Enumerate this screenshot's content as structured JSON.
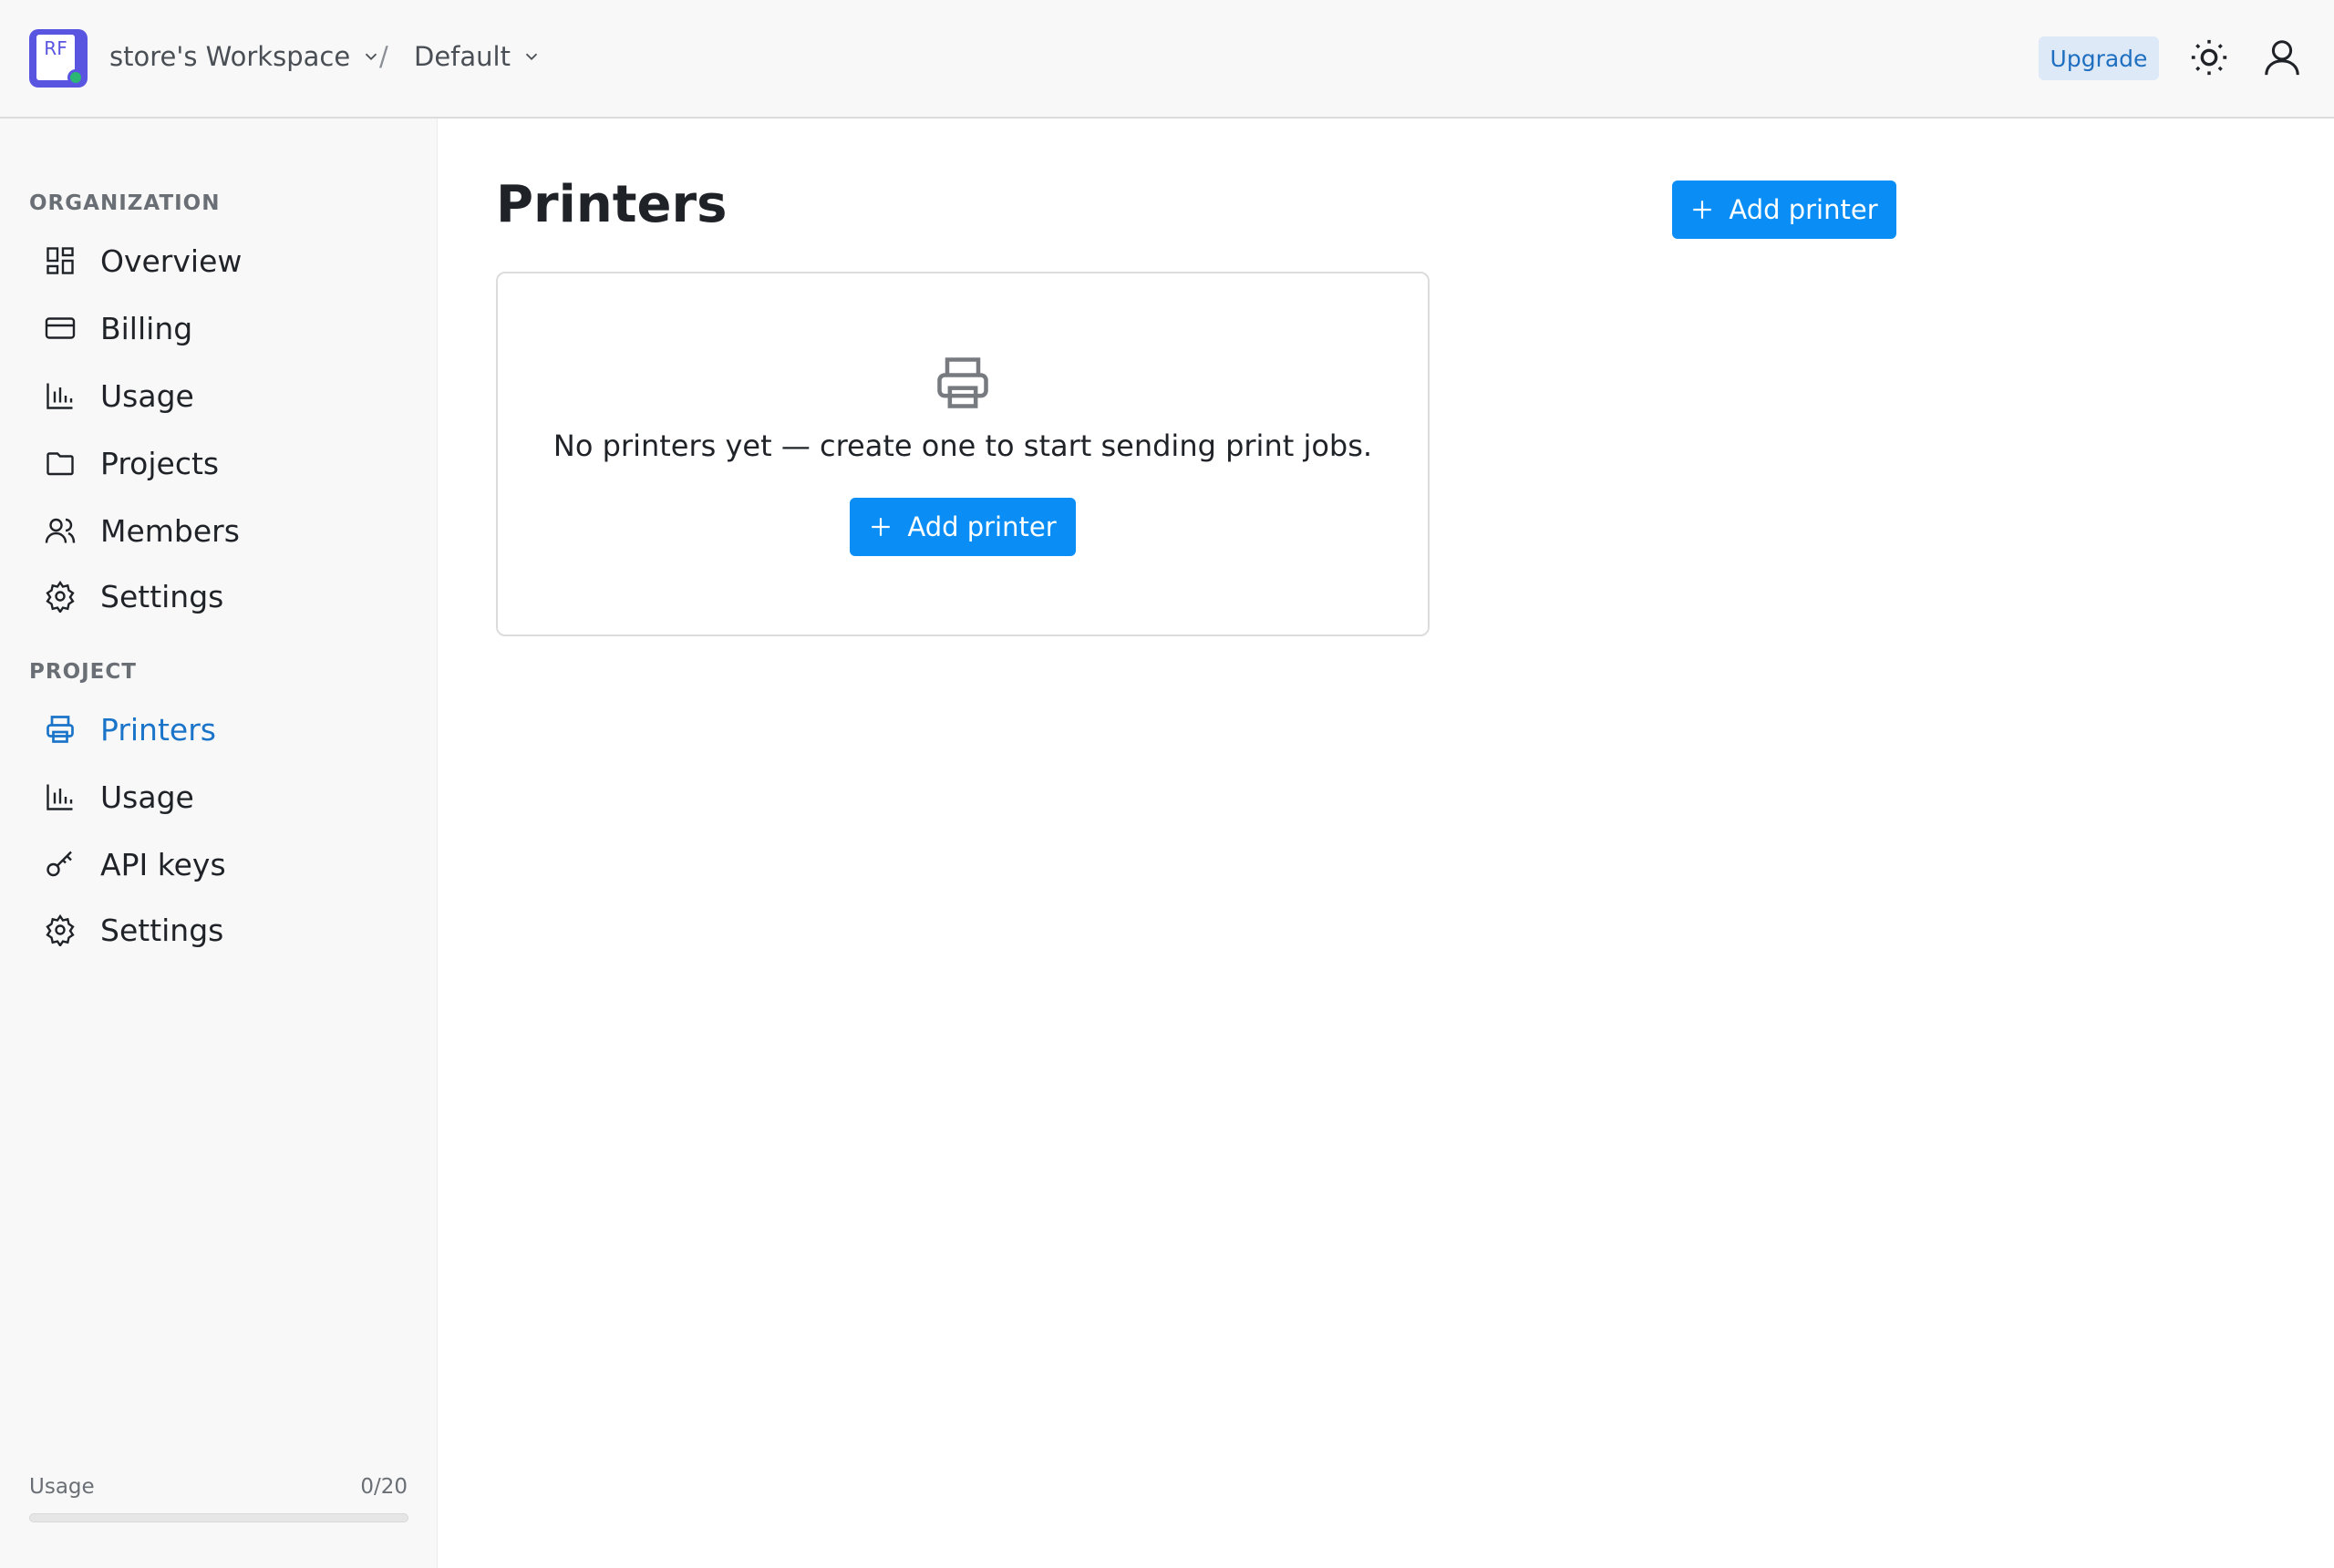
{
  "header": {
    "logo_text": "RF",
    "workspace_label": "store's Workspace",
    "separator": "/",
    "project_label": "Default",
    "upgrade_label": "Upgrade"
  },
  "sidebar": {
    "organization_label": "ORGANIZATION",
    "organization_items": [
      {
        "label": "Overview",
        "icon": "grid-icon"
      },
      {
        "label": "Billing",
        "icon": "credit-card-icon"
      },
      {
        "label": "Usage",
        "icon": "bar-chart-icon"
      },
      {
        "label": "Projects",
        "icon": "folder-icon"
      },
      {
        "label": "Members",
        "icon": "users-icon"
      },
      {
        "label": "Settings",
        "icon": "gear-icon"
      }
    ],
    "project_label": "PROJECT",
    "project_items": [
      {
        "label": "Printers",
        "icon": "printer-icon",
        "active": true
      },
      {
        "label": "Usage",
        "icon": "bar-chart-icon"
      },
      {
        "label": "API keys",
        "icon": "key-icon"
      },
      {
        "label": "Settings",
        "icon": "gear-icon"
      }
    ],
    "usage": {
      "label": "Usage",
      "count": "0/20",
      "fraction": 0
    }
  },
  "main": {
    "title": "Printers",
    "add_button_label": "Add printer",
    "empty_state": {
      "message": "No printers yet — create one to start sending print jobs.",
      "button_label": "Add printer"
    }
  },
  "colors": {
    "accent": "#0a8ef5",
    "active_nav": "#1a74c9",
    "logo": "#5a55e0",
    "upgrade_bg": "#dde9f7"
  }
}
